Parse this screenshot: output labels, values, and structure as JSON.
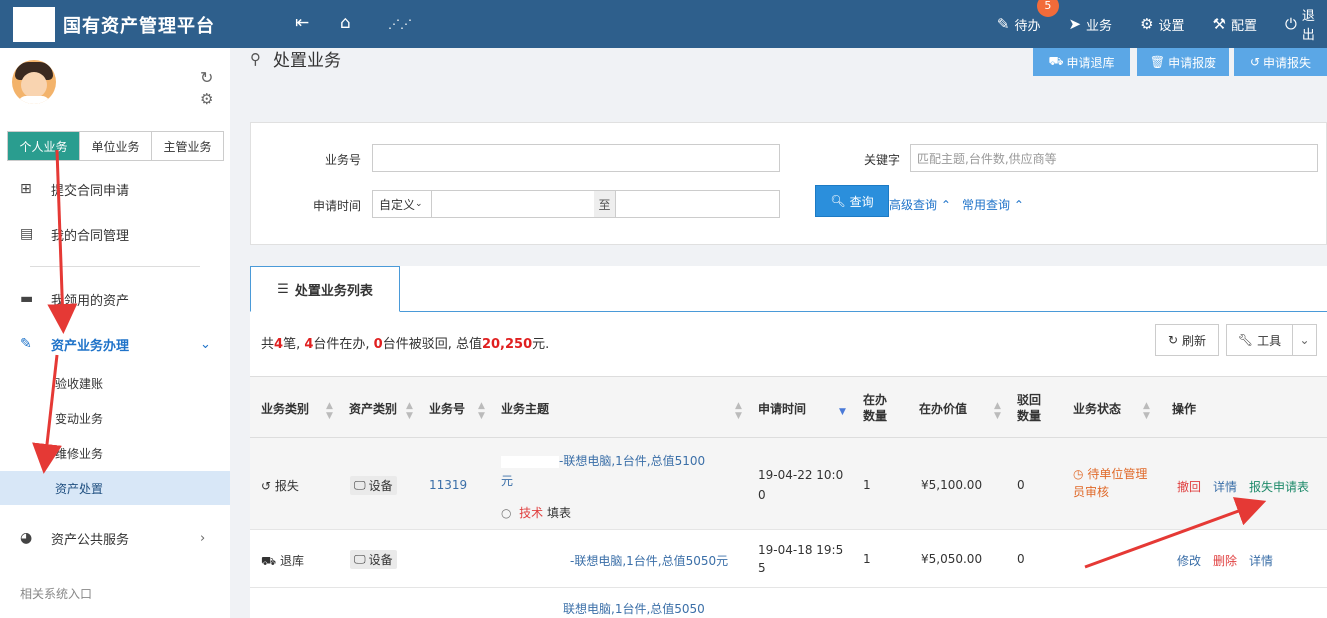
{
  "header": {
    "title": "国有资产管理平台",
    "todo_label": "待办",
    "todo_count": "5",
    "business_label": "业务",
    "settings_label": "设置",
    "config_label": "配置",
    "logout_label": "退出"
  },
  "sidebar": {
    "tabs": [
      "个人业务",
      "单位业务",
      "主管业务"
    ],
    "items": {
      "submit_contract": "提交合同申请",
      "my_contracts": "我的合同管理",
      "my_assets": "我领用的资产",
      "asset_business": "资产业务办理",
      "public_service": "资产公共服务"
    },
    "sub_items": [
      "验收建账",
      "变动业务",
      "维修业务",
      "资产处置"
    ],
    "footer": "相关系统入口"
  },
  "page": {
    "title": "处置业务",
    "actions": [
      "申请退库",
      "申请报废",
      "申请报失"
    ]
  },
  "search": {
    "biz_no_label": "业务号",
    "keyword_label": "关键字",
    "keyword_placeholder": "匹配主题,台件数,供应商等",
    "time_label": "申请时间",
    "time_select": "自定义",
    "to_label": "至",
    "query_button": "查询",
    "advanced_link": "高级查询",
    "common_link": "常用查询"
  },
  "list": {
    "tab_label": "处置业务列表",
    "summary": {
      "p1": "共",
      "total": "4",
      "p2": "笔, ",
      "active": "4",
      "p3": "台件在办, ",
      "rejected": "0",
      "p4": "台件被驳回, 总值",
      "value": "20,250",
      "p5": "元."
    },
    "refresh_button": "刷新",
    "tools_button": "工具",
    "columns": [
      "业务类别",
      "资产类别",
      "业务号",
      "业务主题",
      "申请时间",
      "在办数量",
      "在办价值",
      "驳回数量",
      "业务状态",
      "操作"
    ],
    "rows": [
      {
        "category": "报失",
        "asset_type": "设备",
        "biz_no": "11319",
        "subject_line1": "-联想电脑,1台件,总值5100",
        "subject_line2": "元",
        "handler": "技术",
        "handler_action": "填表",
        "time_line1": "19-04-22 10:0",
        "time_line2": "0",
        "count": "1",
        "value": "¥5,100.00",
        "rejected": "0",
        "status_line1": "待单位管理",
        "status_line2": "员审核",
        "ops": [
          "撤回",
          "详情",
          "报失申请表"
        ]
      },
      {
        "category": "退库",
        "asset_type": "设备",
        "biz_no": "",
        "subject_line1": "-联想电脑,1台件,总值5050元",
        "time_line1": "19-04-18 19:5",
        "time_line2": "5",
        "count": "1",
        "value": "¥5,050.00",
        "rejected": "0",
        "ops": [
          "修改",
          "删除",
          "详情"
        ]
      },
      {
        "subject_line1": "联想电脑,1台件,总值5050"
      }
    ]
  },
  "colors": {
    "header_bg": "#2e5f8c",
    "accent_green": "#2a9d8f",
    "primary_blue": "#2b8fdc",
    "arrow_red": "#e53935"
  }
}
